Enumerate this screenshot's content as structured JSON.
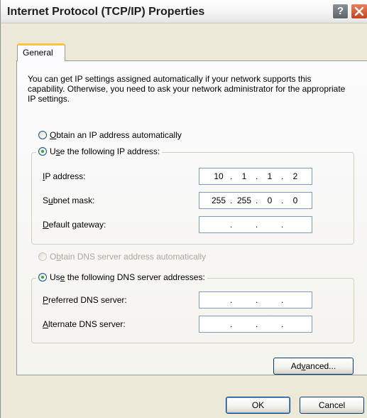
{
  "window": {
    "title": "Internet Protocol (TCP/IP) Properties",
    "help_glyph": "?"
  },
  "tabs": [
    {
      "label": "General",
      "selected": true
    }
  ],
  "intro_text": "You can get IP settings assigned automatically if your network supports this capability. Otherwise, you need to ask your network administrator for the appropriate IP settings.",
  "ip_section": {
    "obtain_auto": {
      "hot": "O",
      "rest": "btain an IP address automatically",
      "selected": false
    },
    "use_following": {
      "hot": "s",
      "pre": "U",
      "rest": "e the following IP address:",
      "selected": true
    },
    "fields": [
      {
        "hot": "I",
        "rest": "P address:",
        "octets": [
          "10",
          "1",
          "1",
          "2"
        ]
      },
      {
        "pre": "S",
        "hot": "u",
        "rest": "bnet mask:",
        "octets": [
          "255",
          "255",
          "0",
          "0"
        ]
      },
      {
        "hot": "D",
        "rest": "efault gateway:",
        "octets": [
          "",
          "",
          "",
          ""
        ]
      }
    ]
  },
  "dns_section": {
    "obtain_auto": {
      "pre": "O",
      "hot": "b",
      "rest": "tain DNS server address automatically",
      "selected": false,
      "disabled": true
    },
    "use_following": {
      "pre": "Us",
      "hot": "e",
      "rest": " the following DNS server addresses:",
      "selected": true
    },
    "fields": [
      {
        "hot": "P",
        "rest": "referred DNS server:",
        "octets": [
          "",
          "",
          "",
          ""
        ]
      },
      {
        "hot": "A",
        "rest": "lternate DNS server:",
        "octets": [
          "",
          "",
          "",
          ""
        ]
      }
    ]
  },
  "buttons": {
    "advanced": {
      "pre": "Ad",
      "hot": "v",
      "rest": "anced..."
    },
    "ok": "OK",
    "cancel": "Cancel"
  },
  "colors": {
    "selection_dot": "#2fa83a",
    "close_button": "#c2441e",
    "tab_highlight": "#ffc83c"
  }
}
